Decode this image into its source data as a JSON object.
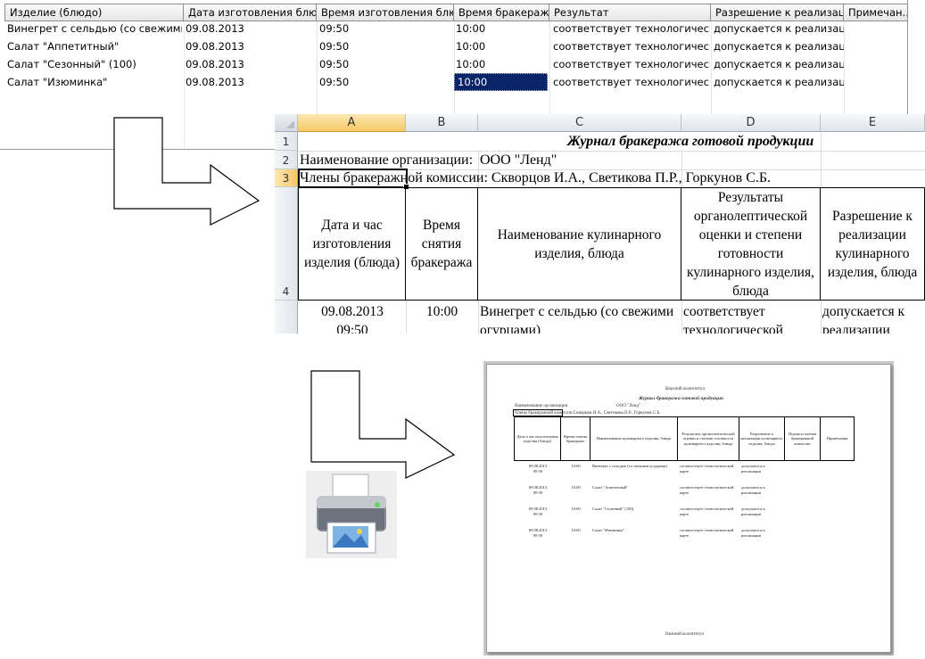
{
  "app_grid": {
    "columns": [
      {
        "label": "Изделие (блюдо)"
      },
      {
        "label": "Дата изготовления блюда"
      },
      {
        "label": "Время изготовления блюда"
      },
      {
        "label": "Время бракеража"
      },
      {
        "label": "Результат"
      },
      {
        "label": "Разрешение к реализации"
      },
      {
        "label": "Примечан..."
      }
    ],
    "rows": [
      {
        "dish": "Винегрет с сельдью (со свежими ог...",
        "date": "09.08.2013",
        "made_time": "09:50",
        "check_time": "10:00",
        "result": "соответствует технологической ...",
        "permission": "допускается к реализации",
        "note": ""
      },
      {
        "dish": "Салат \"Аппетитный\"",
        "date": "09.08.2013",
        "made_time": "09:50",
        "check_time": "10:00",
        "result": "соответствует технологической ...",
        "permission": "допускается к реализации",
        "note": ""
      },
      {
        "dish": "Салат \"Сезонный\" (100)",
        "date": "09.08.2013",
        "made_time": "09:50",
        "check_time": "10:00",
        "result": "соответствует технологической ...",
        "permission": "допускается к реализации",
        "note": ""
      },
      {
        "dish": "Салат \"Изюминка\"",
        "date": "09.08.2013",
        "made_time": "09:50",
        "check_time": "10:00",
        "result": "соответствует технологической ...",
        "permission": "допускается к реализации",
        "note": ""
      }
    ]
  },
  "sheet": {
    "columns": [
      "A",
      "B",
      "C",
      "D",
      "E"
    ],
    "row_numbers": [
      "1",
      "2",
      "3",
      "4"
    ],
    "title": "Журнал бракеража готовой продукции",
    "org_label": "Наименование организации:",
    "org_value": "ООО \"Ленд\"",
    "commission": "Члены бракеражной комиссии: Скворцов И.А., Светикова П.Р., Горкунов С.Б.",
    "headers": {
      "date_time": "Дата и час изготовления изделия (блюда)",
      "check_time": "Время снятия бракеража",
      "dish_name": "Наименование кулинарного изделия, блюда",
      "results": "Результаты органолептической оценки и степени готовности кулинарного изделия, блюда",
      "permission": "Разрешение к реализации кулинарного изделия, блюда"
    },
    "first_row": {
      "date": "09.08.2013",
      "time": "09:50",
      "check_time": "10:00",
      "dish": "Винегрет с сельдью (со свежими огурцами)",
      "result": "соответствует технологической",
      "permission": "допускается к реализации"
    }
  },
  "preview": {
    "header_footer_top": "Верхний колонтитул",
    "title": "Журнал бракеража готовой продукции",
    "org_label": "Наименование организации",
    "org_value": "ООО \"Ленд\"",
    "commission": "Члены бракеражной комиссии  Скворцов И.А., Светикова П.Р., Горкунов С.Б.",
    "headers": {
      "date_time": "Дата и час изготовления изделия (блюда)",
      "check_time": "Время снятия бракеража",
      "dish_name": "Наименование кулинарного изделия, блюда",
      "results": "Результаты органолептической оценки и степени готовности кулинарного изделия, блюда",
      "permission": "Разрешение к реализации кулинарного изделия, блюда",
      "signatures": "Подписи членов бракеражной комиссии",
      "notes": "Примечания"
    },
    "rows": [
      {
        "date": "09.08.2013",
        "time": "09:50",
        "check": "10:00",
        "dish": "Винегрет с сельдью (со свежими огурцами)",
        "result": "соответствует технологической карте",
        "permission": "допускается к реализации"
      },
      {
        "date": "09.08.2013",
        "time": "09:50",
        "check": "10:00",
        "dish": "Салат \"Аппетитный\"",
        "result": "соответствует технологической карте",
        "permission": "допускается к реализации"
      },
      {
        "date": "09.08.2013",
        "time": "09:50",
        "check": "10:00",
        "dish": "Салат \"Сезонный\" (100)",
        "result": "соответствует технологической карте",
        "permission": "допускается к реализации"
      },
      {
        "date": "09.08.2013",
        "time": "09:50",
        "check": "10:00",
        "dish": "Салат \"Изюминка\"",
        "result": "соответствует технологической карте",
        "permission": "допускается к реализации"
      }
    ],
    "footer": "Нижний колонтитул"
  },
  "icons": {
    "arrow_1": "right-arrow-icon",
    "arrow_2": "right-arrow-icon",
    "printer": "printer-icon"
  },
  "colors": {
    "selection": "#0a246a",
    "active_header": "#f6c868"
  }
}
